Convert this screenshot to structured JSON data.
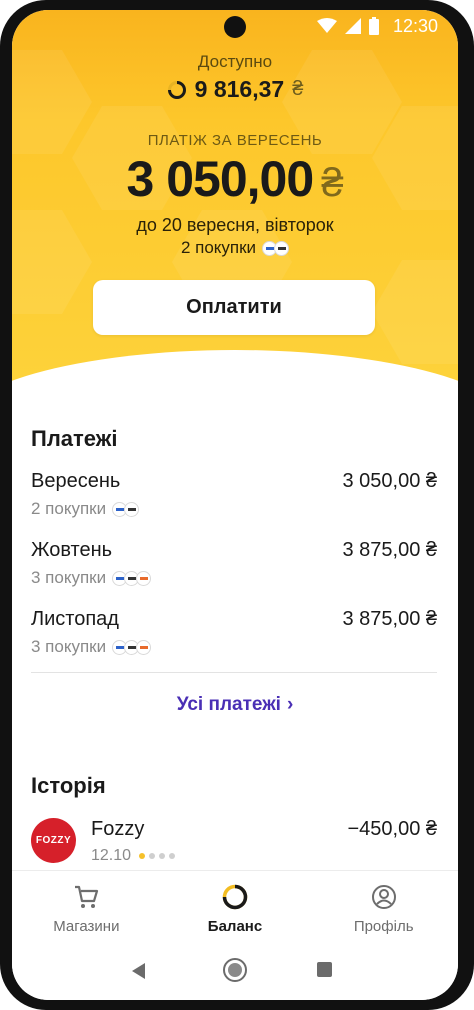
{
  "status_bar": {
    "time": "12:30"
  },
  "balance": {
    "available_label": "Доступно",
    "available_value": "9 816,37",
    "currency": "₴"
  },
  "payment": {
    "label": "ПЛАТІЖ ЗА ВЕРЕСЕНЬ",
    "amount": "3 050,00",
    "currency": "₴",
    "due": "до 20 вересня, вівторок",
    "purchases": "2 покупки",
    "pay_button": "Оплатити"
  },
  "payments_section": {
    "title": "Платежі",
    "items": [
      {
        "month": "Вересень",
        "sum": "3 050,00 ₴",
        "purchases": "2 покупки",
        "merchant_icons": [
          "bank-logo-icon",
          "store-logo-icon"
        ]
      },
      {
        "month": "Жовтень",
        "sum": "3 875,00 ₴",
        "purchases": "3 покупки",
        "merchant_icons": [
          "bank-logo-icon",
          "store-logo-icon",
          "shop-logo-icon"
        ]
      },
      {
        "month": "Листопад",
        "sum": "3 875,00 ₴",
        "purchases": "3 покупки",
        "merchant_icons": [
          "bank-logo-icon",
          "store-logo-icon",
          "shop-logo-icon"
        ]
      }
    ],
    "all_link": "Усі платежі"
  },
  "history": {
    "title": "Історія",
    "items": [
      {
        "name": "Fozzy",
        "logo_text": "FOZZY",
        "amount": "−450,00 ₴",
        "date": "12.10",
        "progress_paid": 1,
        "progress_total": 4
      }
    ]
  },
  "bottom_nav": {
    "items": [
      {
        "label": "Магазини",
        "icon": "cart-icon",
        "active": false
      },
      {
        "label": "Баланс",
        "icon": "balance-ring-icon",
        "active": true
      },
      {
        "label": "Профіль",
        "icon": "profile-icon",
        "active": false
      }
    ]
  },
  "colors": {
    "accent_yellow": "#fdc72b",
    "link_purple": "#4a2fb5",
    "fozzy_red": "#d6202a"
  }
}
